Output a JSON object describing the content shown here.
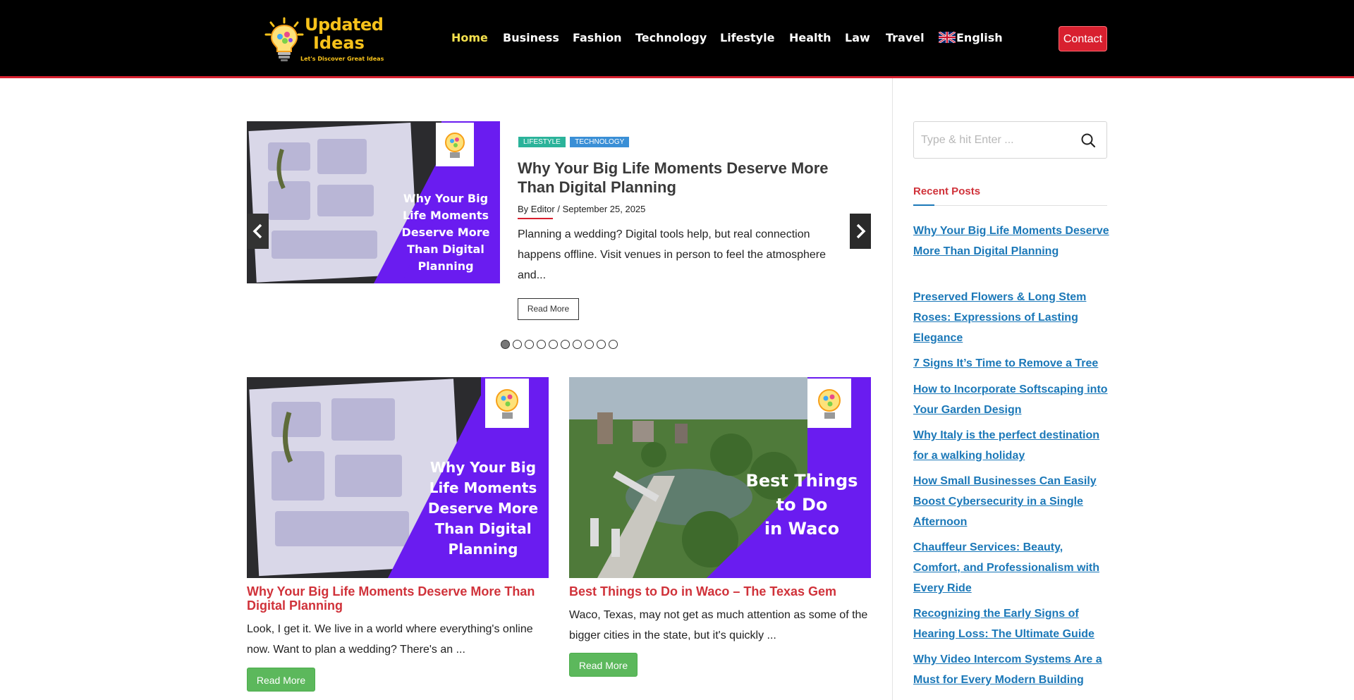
{
  "site": {
    "logo_line1": "Updated",
    "logo_line2": "Ideas",
    "logo_tagline": "Let's Discover Great Ideas"
  },
  "nav": {
    "items": [
      "Home",
      "Business",
      "Fashion",
      "Technology",
      "Lifestyle",
      "Health",
      "Law",
      "Travel",
      "English"
    ],
    "active": "Home",
    "contact_label": "Contact"
  },
  "colors": {
    "header_bg": "#000000",
    "accent_red": "#d8202f",
    "active_nav": "#f4e04d",
    "link_blue": "#1b78b8",
    "button_green": "#5cb85c",
    "slide_purple": "#6a1cf0"
  },
  "slider": {
    "image_text": "Why Your Big Life Moments Deserve More Than Digital Planning",
    "categories": [
      "LIFESTYLE",
      "TECHNOLOGY"
    ],
    "title": "Why Your Big Life Moments Deserve More Than Digital Planning",
    "meta": "By Editor / September 25, 2025",
    "excerpt": "Planning a wedding? Digital tools help, but real connection happens offline. Visit venues in person to feel the atmosphere and...",
    "read_more": "Read More",
    "prev_icon": "chevron-left-icon",
    "next_icon": "chevron-right-icon",
    "total_slides": 10,
    "current_slide": 1
  },
  "posts": [
    {
      "image_text": "Why Your Big Life Moments Deserve More Than Digital Planning",
      "title": "Why Your Big Life Moments Deserve More Than Digital Planning",
      "excerpt": "Look, I get it. We live in a world where everything's online now. Want to plan a wedding? There's an ...",
      "read_more": "Read More"
    },
    {
      "image_text": "Best Things to Do in Waco",
      "title": "Best Things to Do in Waco – The Texas Gem",
      "excerpt": "Waco, Texas, may not get as much attention as some of the bigger cities in the state, but it's quickly ...",
      "read_more": "Read More"
    }
  ],
  "sidebar": {
    "search_placeholder": "Type & hit Enter ...",
    "recent_heading": "Recent Posts",
    "recent_posts": [
      "Why Your Big Life Moments Deserve More Than Digital Planning",
      "Preserved Flowers & Long Stem Roses: Expressions of Lasting Elegance",
      "7 Signs It’s Time to Remove a Tree",
      "How to Incorporate Softscaping into Your Garden Design",
      "Why Italy is the perfect destination for a walking holiday",
      "How Small Businesses Can Easily Boost Cybersecurity in a Single Afternoon",
      "Chauffeur Services: Beauty, Comfort, and Professionalism with Every Ride",
      "Recognizing the Early Signs of Hearing Loss: The Ultimate Guide",
      "Why Video Intercom Systems Are a Must for Every Modern Building"
    ]
  }
}
